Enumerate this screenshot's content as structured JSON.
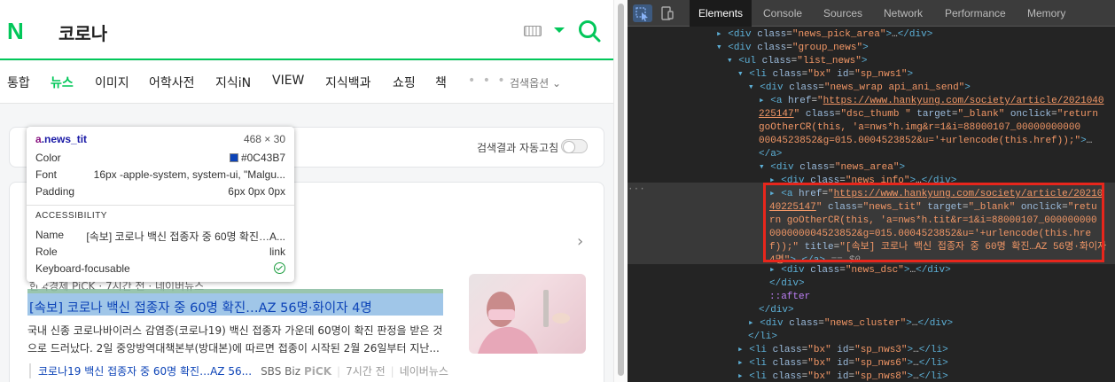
{
  "browser": {
    "logo": "N",
    "query": "코로나",
    "tabs": [
      "통합",
      "뉴스",
      "이미지",
      "어학사전",
      "지식iN",
      "VIEW",
      "지식백과",
      "쇼핑",
      "책"
    ],
    "active_tab": "뉴스",
    "more": "• • •",
    "search_options": "검색옵션 ⌄",
    "auto_refresh_label": "검색결과 자동고침",
    "press_row": "한국경제 PiCK · 7시간 전 · 네이버뉴스",
    "news_title": "[속보] 코로나 백신 접종자 중 60명 확진…AZ 56명·화이자 4명",
    "news_dsc_line1": "국내 신종 코로나바이러스 감염증(코로나19) 백신 접종자 가운데 60명이 확진 판정을 받은 것",
    "news_dsc_line2": "으로 드러났다. 2일 중앙방역대책본부(방대본)에 따르면 접종이 시작된 2월 26일부터 지난...",
    "cluster_link": "코로나19 백신 접종자 중 60명 확진…AZ 56...",
    "cluster_press": "SBS Biz",
    "cluster_pick": "PiCK",
    "cluster_time": "7시간 전",
    "cluster_naver": "네이버뉴스"
  },
  "tooltip": {
    "tag": "a",
    "class": ".news_tit",
    "size": "468 × 30",
    "color_label": "Color",
    "color_value": "#0C43B7",
    "font_label": "Font",
    "font_value": "16px -apple-system, system-ui, \"Malgu...",
    "padding_label": "Padding",
    "padding_value": "6px 0px 0px",
    "accessibility_header": "ACCESSIBILITY",
    "name_label": "Name",
    "name_value": "[속보] 코로나 백신 접종자 중 60명 확진…A...",
    "role_label": "Role",
    "role_value": "link",
    "keyboard_label": "Keyboard-focusable"
  },
  "devtools": {
    "tabs": [
      "Elements",
      "Console",
      "Sources",
      "Network",
      "Performance",
      "Memory"
    ],
    "active_tab": "Elements"
  },
  "colors": {
    "naver_green": "#03c75a",
    "link_blue": "#0C43B7",
    "devtools_bg": "#242424",
    "selection_border": "#e8261c"
  }
}
